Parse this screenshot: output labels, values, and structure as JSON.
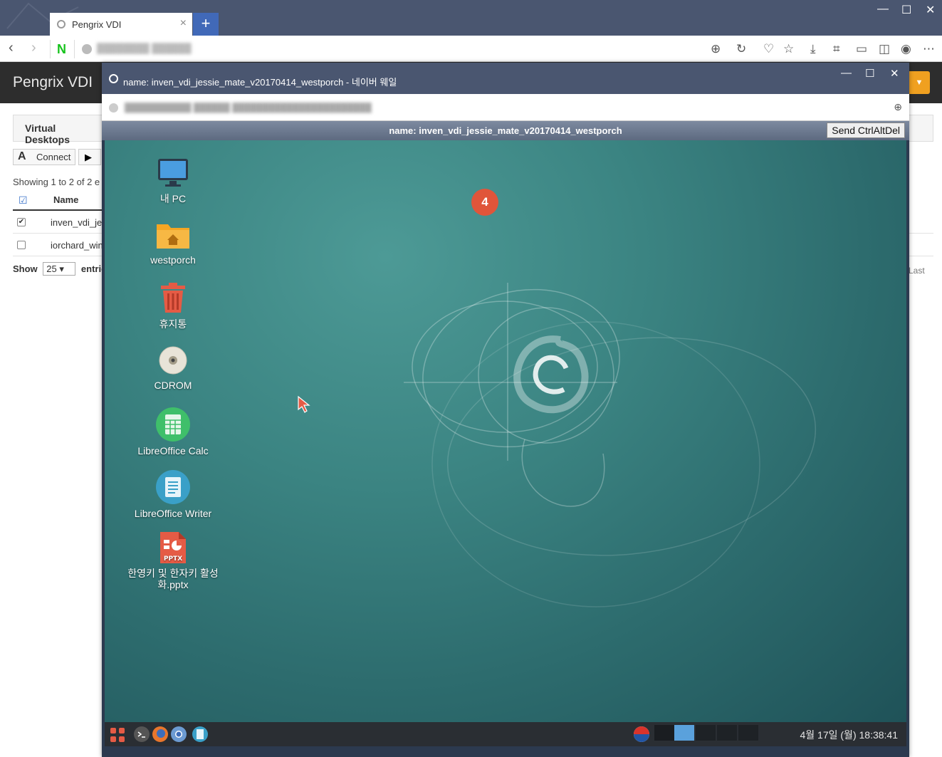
{
  "browser": {
    "tab_title": "Pengrix VDI",
    "tab_close": "×",
    "new_tab": "+",
    "naver_logo": "N",
    "window_controls": {
      "minimize": "—",
      "maximize": "☐",
      "close": "✕"
    }
  },
  "app": {
    "brand": "Pengrix VDI",
    "section_tab": "Virtual Desktops",
    "connect_label": "Connect",
    "showing_text": "Showing 1 to 2 of 2 e",
    "table": {
      "header_name": "Name",
      "rows": [
        {
          "name": "inven_vdi_je",
          "checked": true
        },
        {
          "name": "iorchard_win",
          "checked": false
        }
      ]
    },
    "show_label": "Show",
    "page_size": "25",
    "entries_label": "entrie",
    "last_label": "Last"
  },
  "popup": {
    "title": "name: inven_vdi_jessie_mate_v20170414_westporch - 네이버 웨일",
    "controls": {
      "minimize": "—",
      "maximize": "☐",
      "close": "✕"
    }
  },
  "vnc": {
    "bar_title": "name: inven_vdi_jessie_mate_v20170414_westporch",
    "send_button": "Send CtrlAltDel"
  },
  "desktop": {
    "icons": [
      {
        "label": "내 PC",
        "icon": "monitor-icon"
      },
      {
        "label": "westporch",
        "icon": "home-folder-icon"
      },
      {
        "label": "휴지통",
        "icon": "trash-icon"
      },
      {
        "label": "CDROM",
        "icon": "cdrom-icon"
      },
      {
        "label": "LibreOffice Calc",
        "icon": "calc-icon"
      },
      {
        "label": "LibreOffice Writer",
        "icon": "writer-icon"
      },
      {
        "label": "한영키 및 한자키 활성화.pptx",
        "icon": "pptx-icon"
      }
    ],
    "pptx_badge": "PPTX",
    "annotation_badge": "4",
    "clock": "4월 17일 (월) 18:38:41",
    "colors": {
      "accent_orange": "#e0553a",
      "desktop_teal": "#3b8482"
    }
  }
}
